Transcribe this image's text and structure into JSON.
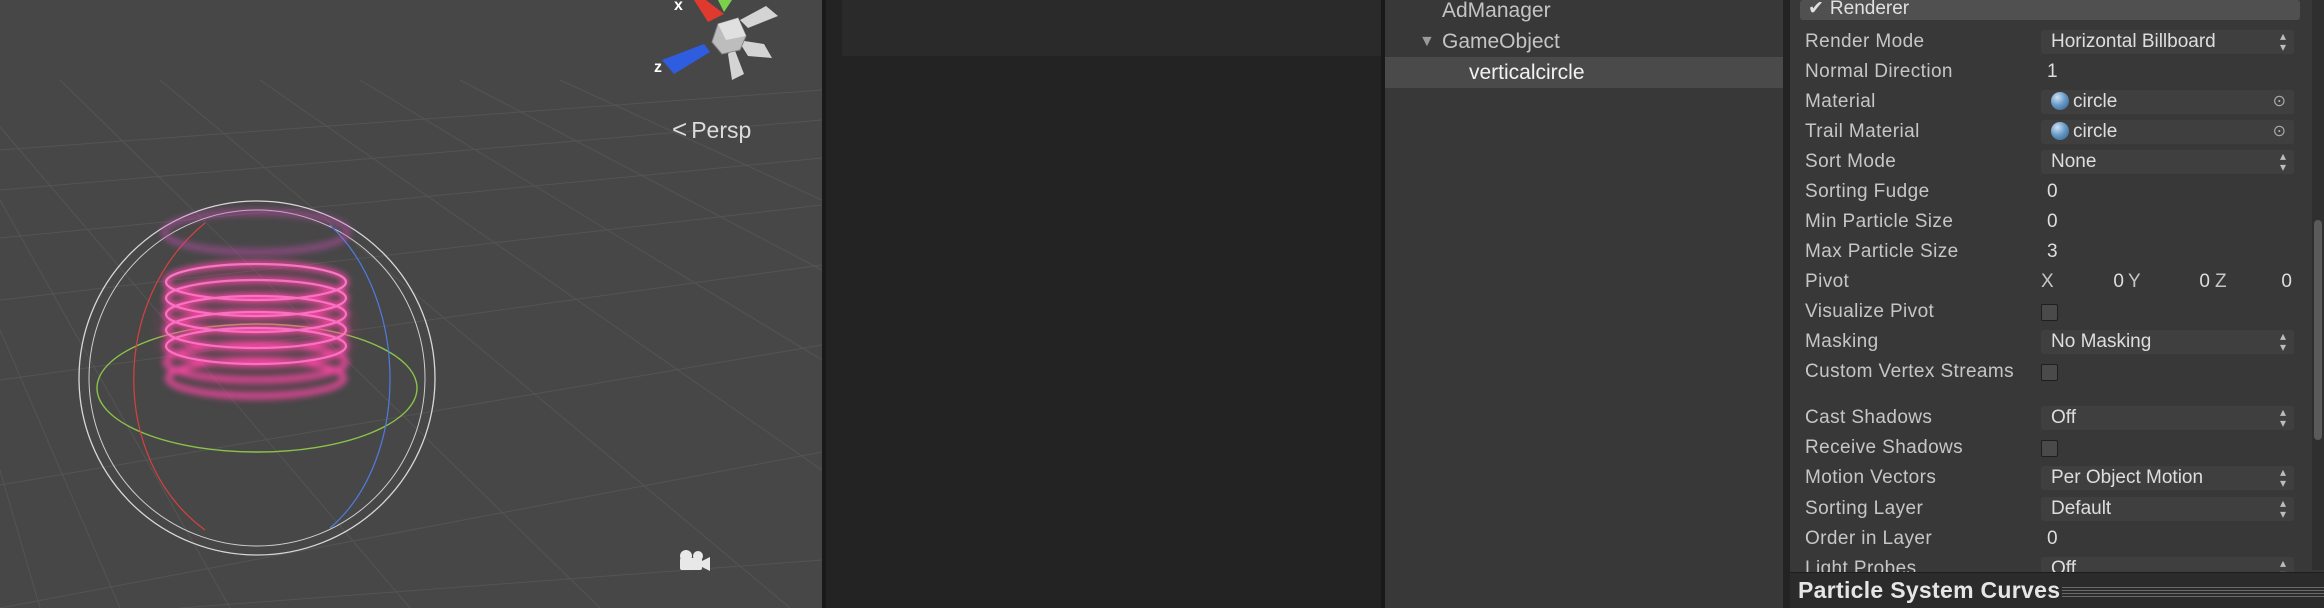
{
  "scene": {
    "gizmo_axes": {
      "x": "x",
      "z": "z"
    },
    "projection_label": "Persp",
    "camera_icon": "camera-icon"
  },
  "hierarchy": {
    "items": [
      {
        "label": "AdManager",
        "expanded": false
      },
      {
        "label": "GameObject",
        "expanded": true
      },
      {
        "label": "verticalcircle",
        "selected": true
      }
    ]
  },
  "inspector": {
    "section_title": "Renderer",
    "rows": {
      "render_mode": {
        "label": "Render Mode",
        "value": "Horizontal Billboard"
      },
      "normal_direction": {
        "label": "Normal Direction",
        "value": "1"
      },
      "material": {
        "label": "Material",
        "value": "circle"
      },
      "trail_material": {
        "label": "Trail Material",
        "value": "circle"
      },
      "sort_mode": {
        "label": "Sort Mode",
        "value": "None"
      },
      "sorting_fudge": {
        "label": "Sorting Fudge",
        "value": "0"
      },
      "min_particle_size": {
        "label": "Min Particle Size",
        "value": "0"
      },
      "max_particle_size": {
        "label": "Max Particle Size",
        "value": "3"
      },
      "pivot": {
        "label": "Pivot",
        "x_label": "X",
        "x": "0",
        "y_label": "Y",
        "y": "0",
        "z_label": "Z",
        "z": "0"
      },
      "visualize_pivot": {
        "label": "Visualize Pivot",
        "checked": false
      },
      "masking": {
        "label": "Masking",
        "value": "No Masking"
      },
      "custom_vertex_streams": {
        "label": "Custom Vertex Streams",
        "checked": false
      },
      "cast_shadows": {
        "label": "Cast Shadows",
        "value": "Off"
      },
      "receive_shadows": {
        "label": "Receive Shadows",
        "checked": false
      },
      "motion_vectors": {
        "label": "Motion Vectors",
        "value": "Per Object Motion"
      },
      "sorting_layer": {
        "label": "Sorting Layer",
        "value": "Default"
      },
      "order_in_layer": {
        "label": "Order in Layer",
        "value": "0"
      },
      "light_probes": {
        "label": "Light Probes",
        "value": "Off"
      }
    }
  },
  "curves_panel": {
    "title": "Particle System Curves"
  },
  "colors": {
    "scene_bg": "#474747",
    "game_bg": "#232323",
    "panel_bg": "#383838",
    "particle_ring": "#ff3c9a",
    "selection": "#4a4a4a"
  }
}
